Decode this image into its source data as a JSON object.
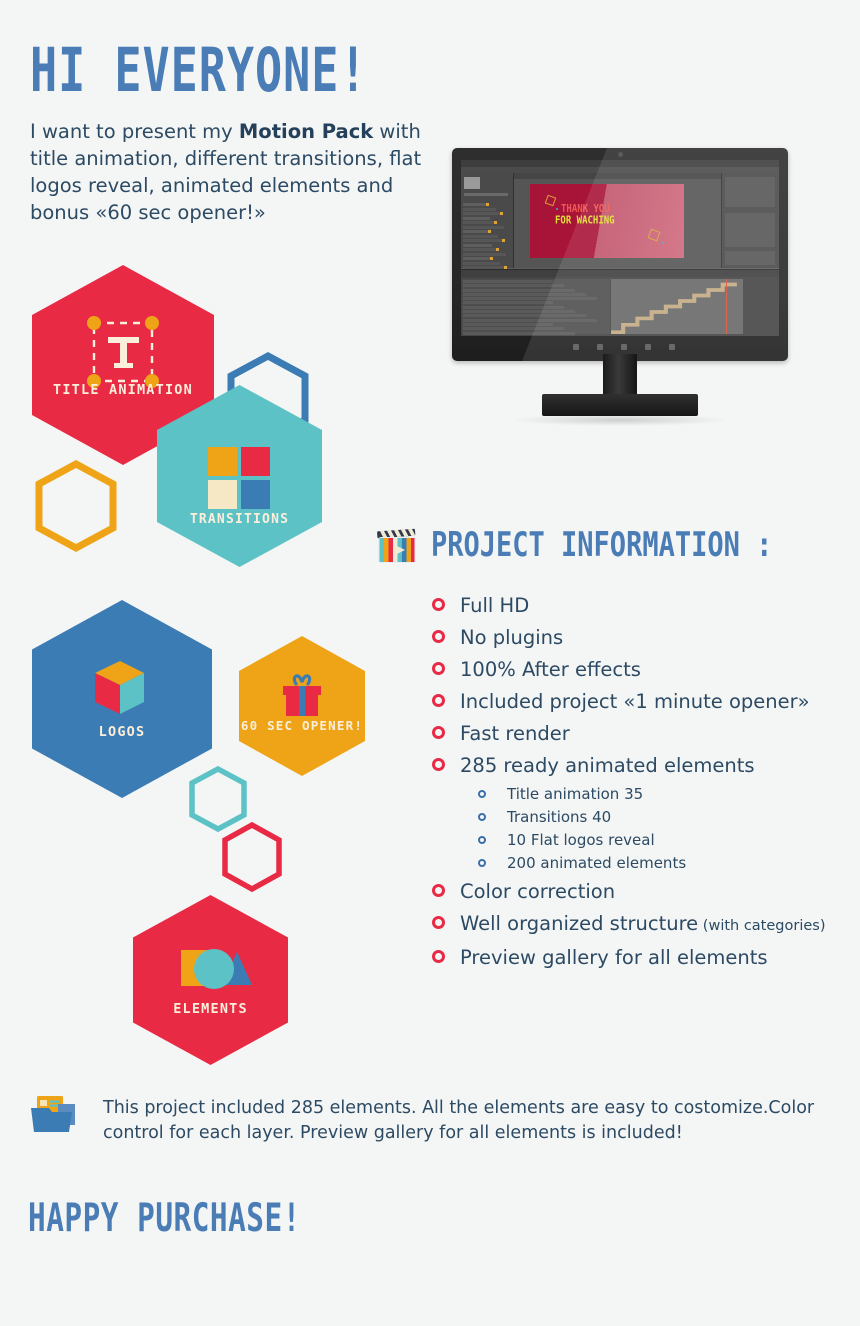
{
  "headline": "HI EVERYONE!",
  "intro": {
    "before": "I want to present my ",
    "bold": "Motion Pack",
    "after": " with title animation, different transitions, flat logos reveal, animated elements and bonus «60 sec opener!»"
  },
  "monitor": {
    "preview_line1": "THANK YOU",
    "preview_line2": "FOR WACHING"
  },
  "hexagons": [
    {
      "label": "TITLE ANIMATION",
      "color": "#e82a45",
      "icon": "title-animation-icon",
      "filled": true
    },
    {
      "label": "TRANSITIONS",
      "color": "#5cc2c6",
      "icon": "transitions-grid-icon",
      "filled": true
    },
    {
      "label": "LOGOS",
      "color": "#3c7cb5",
      "icon": "cube-icon",
      "filled": true
    },
    {
      "label": "60 SEC OPENER!",
      "color": "#efa417",
      "icon": "gift-icon",
      "filled": true
    },
    {
      "label": "ELEMENTS",
      "color": "#e82a45",
      "icon": "shapes-icon",
      "filled": true
    }
  ],
  "outline_hexagons": [
    {
      "color": "#3c7cb5",
      "name": "outline-hexagon-blue"
    },
    {
      "color": "#efa417",
      "name": "outline-hexagon-orange"
    },
    {
      "color": "#5cc2c6",
      "name": "outline-hexagon-teal"
    },
    {
      "color": "#e82a45",
      "name": "outline-hexagon-red"
    }
  ],
  "info": {
    "title": "PROJECT INFORMATION :",
    "icon": "clapperboard-icon",
    "items": [
      {
        "text": "Full HD"
      },
      {
        "text": "No plugins"
      },
      {
        "text": "100% After effects"
      },
      {
        "text": "Included project «1 minute opener»"
      },
      {
        "text": "Fast render"
      },
      {
        "text": "285 ready animated elements",
        "sub": [
          "Title animation 35",
          "Transitions 40",
          "10 Flat logos reveal",
          "200 animated elements"
        ]
      },
      {
        "text": "Color correction"
      },
      {
        "text": "Well organized structure",
        "note": "(with categories)"
      },
      {
        "text": "Preview gallery for all elements"
      }
    ]
  },
  "footer": {
    "icon": "folder-icon",
    "text": "This project included 285 elements. All the elements are easy to costomize.Color control for each layer. Preview  gallery  for all elements is included!",
    "closing": "HAPPY PURCHASE!"
  },
  "colors": {
    "background": "#f4f5f5",
    "brand_blue": "#4a7cb5",
    "brand_red": "#e82a45",
    "brand_orange": "#efa417",
    "brand_teal": "#5cc2c6",
    "text_dark": "#2c4a63",
    "cream": "#fbeedb"
  }
}
